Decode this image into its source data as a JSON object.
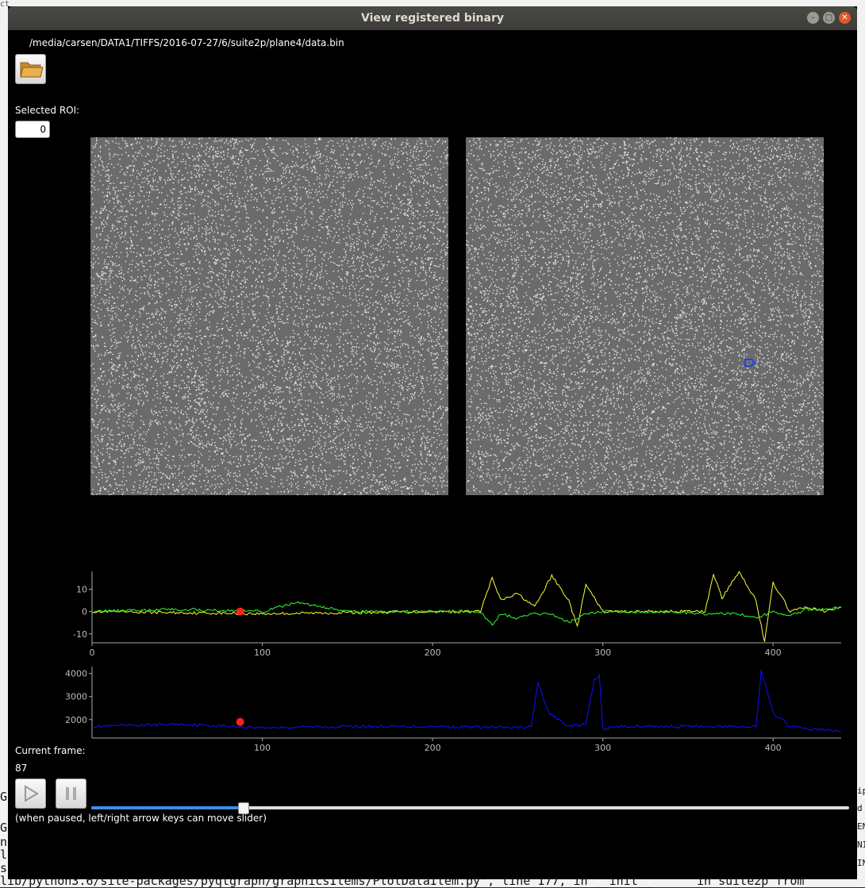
{
  "window": {
    "title": "View registered binary"
  },
  "file": {
    "path": "/media/carsen/DATA1/TIFFS/2016-07-27/6/suite2p/plane4/data.bin"
  },
  "roi": {
    "label": "Selected ROI:",
    "value": "0"
  },
  "frame": {
    "label": "Current frame:",
    "value": "87"
  },
  "slider": {
    "hint": "(when paused, left/right arrow keys can move slider)",
    "position_fraction": 0.2
  },
  "icons": {
    "open": "folder-icon",
    "play": "play-icon",
    "pause": "pause-icon"
  },
  "colors": {
    "trace_green": "#30ff30",
    "trace_yellow": "#ffff30",
    "trace_blue": "#1010ff",
    "marker": "#ff2020",
    "slider": "#3d8ee6"
  },
  "terminal": {
    "left_lines": [
      "ct",
      "G",
      "G",
      "n",
      "l",
      "s"
    ],
    "bottom_line": "lib/python3.6/site-packages/pyqtgraph/graphicsItems/PlotDataItem.py\", line 177, in __init__",
    "bottom_right": "in suite2p from",
    "right_lines": [
      "ip",
      "d",
      "EN",
      "NI",
      "IN"
    ]
  },
  "plot1": {
    "y_ticks": [
      "10",
      "0",
      "-10"
    ],
    "x_ticks": [
      "0",
      "100",
      "200",
      "300",
      "400"
    ]
  },
  "plot2": {
    "y_ticks": [
      "4000",
      "3000",
      "2000"
    ],
    "x_ticks": [
      "100",
      "200",
      "300",
      "400"
    ]
  },
  "chart_data": [
    {
      "type": "line",
      "title": "",
      "xlim": [
        0,
        440
      ],
      "ylim": [
        -14,
        18
      ],
      "x_ticks": [
        0,
        100,
        200,
        300,
        400
      ],
      "y_ticks": [
        10,
        0,
        -10
      ],
      "series": [
        {
          "color": "#ffff30",
          "x": [
            0,
            100,
            200,
            228,
            235,
            240,
            250,
            260,
            270,
            280,
            285,
            290,
            300,
            320,
            340,
            360,
            365,
            370,
            380,
            390,
            395,
            400,
            410,
            420,
            430,
            440
          ],
          "values": [
            0,
            -1,
            0,
            0,
            15,
            5,
            8,
            2,
            16,
            5,
            -7,
            12,
            0,
            0,
            0,
            0,
            17,
            6,
            18,
            5,
            -14,
            13,
            0,
            2,
            0,
            2
          ]
        },
        {
          "color": "#30ff30",
          "x": [
            0,
            50,
            100,
            120,
            150,
            200,
            228,
            235,
            240,
            250,
            260,
            270,
            280,
            290,
            300,
            320,
            340,
            360,
            380,
            390,
            400,
            410,
            420,
            430,
            440
          ],
          "values": [
            0,
            1,
            0,
            4,
            0,
            0,
            0,
            -6,
            -1,
            -3,
            -1,
            -1,
            -5,
            -1,
            0,
            0,
            0,
            -1,
            -1,
            -3,
            0,
            -2,
            1,
            1,
            2
          ]
        }
      ],
      "marker": {
        "x": 87,
        "y": 0
      }
    },
    {
      "type": "line",
      "title": "",
      "xlim": [
        0,
        440
      ],
      "ylim": [
        1200,
        4300
      ],
      "x_ticks": [
        100,
        200,
        300,
        400
      ],
      "y_ticks": [
        4000,
        3000,
        2000
      ],
      "series": [
        {
          "color": "#1010ff",
          "x": [
            0,
            50,
            100,
            150,
            200,
            250,
            258,
            262,
            268,
            280,
            290,
            295,
            298,
            300,
            310,
            350,
            390,
            393,
            400,
            410,
            420,
            440
          ],
          "values": [
            1700,
            1800,
            1650,
            1700,
            1700,
            1650,
            1700,
            3600,
            2300,
            1700,
            1800,
            3700,
            3900,
            1600,
            1700,
            1700,
            1700,
            4100,
            2300,
            1700,
            1600,
            1500
          ]
        }
      ],
      "marker": {
        "x": 87,
        "y": 1900
      }
    }
  ]
}
